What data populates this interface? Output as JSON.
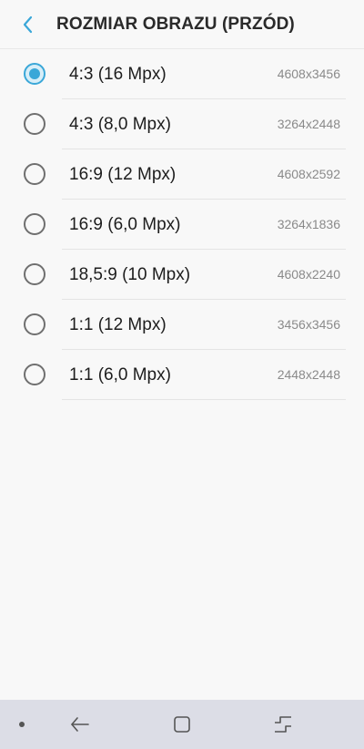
{
  "header": {
    "title": "ROZMIAR OBRAZU (PRZÓD)"
  },
  "options": [
    {
      "label": "4:3 (16 Mpx)",
      "resolution": "4608x3456",
      "selected": true
    },
    {
      "label": "4:3 (8,0 Mpx)",
      "resolution": "3264x2448",
      "selected": false
    },
    {
      "label": "16:9 (12 Mpx)",
      "resolution": "4608x2592",
      "selected": false
    },
    {
      "label": "16:9 (6,0 Mpx)",
      "resolution": "3264x1836",
      "selected": false
    },
    {
      "label": "18,5:9 (10 Mpx)",
      "resolution": "4608x2240",
      "selected": false
    },
    {
      "label": "1:1 (12 Mpx)",
      "resolution": "3456x3456",
      "selected": false
    },
    {
      "label": "1:1 (6,0 Mpx)",
      "resolution": "2448x2448",
      "selected": false
    }
  ],
  "colors": {
    "accent": "#3aa7d8",
    "navbar": "#dcdde6"
  },
  "icons": {
    "back": "chevron-left-icon",
    "nav_back": "back-arrow-icon",
    "nav_home": "home-square-icon",
    "nav_recents": "recents-icon"
  }
}
